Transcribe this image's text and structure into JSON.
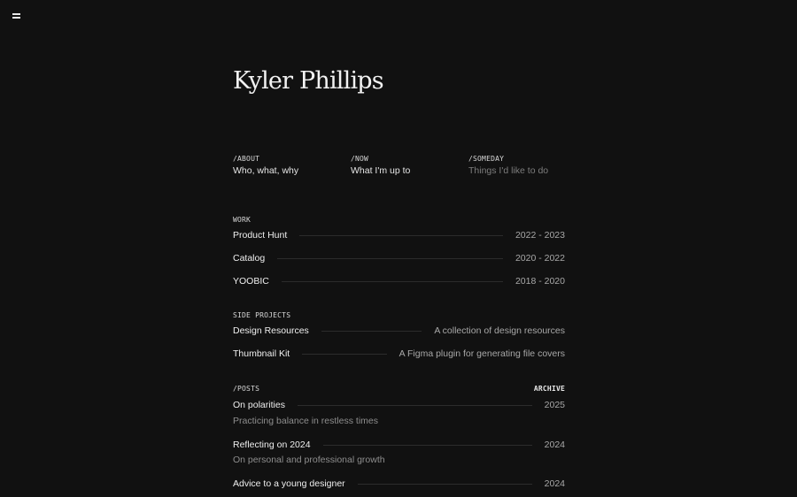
{
  "header": {
    "name": "Kyler Phillips"
  },
  "nav": [
    {
      "label": "/ABOUT",
      "text": "Who, what, why"
    },
    {
      "label": "/NOW",
      "text": "What I'm up to"
    },
    {
      "label": "/SOMEDAY",
      "text": "Things I'd like to do"
    }
  ],
  "work": {
    "label": "WORK",
    "items": [
      {
        "name": "Product Hunt",
        "years": "2022 - 2023"
      },
      {
        "name": "Catalog",
        "years": "2020 - 2022"
      },
      {
        "name": "YOOBIC",
        "years": "2018 - 2020"
      }
    ]
  },
  "side_projects": {
    "label": "SIDE PROJECTS",
    "items": [
      {
        "name": "Design Resources",
        "desc": "A collection of design resources"
      },
      {
        "name": "Thumbnail Kit",
        "desc": "A Figma plugin for generating file covers"
      }
    ]
  },
  "posts": {
    "label": "/POSTS",
    "archive_label": "ARCHIVE",
    "items": [
      {
        "title": "On polarities",
        "year": "2025",
        "subtitle": "Practicing balance in restless times"
      },
      {
        "title": "Reflecting on 2024",
        "year": "2024",
        "subtitle": "On personal and professional growth"
      },
      {
        "title": "Advice to a young designer",
        "year": "2024"
      }
    ]
  }
}
